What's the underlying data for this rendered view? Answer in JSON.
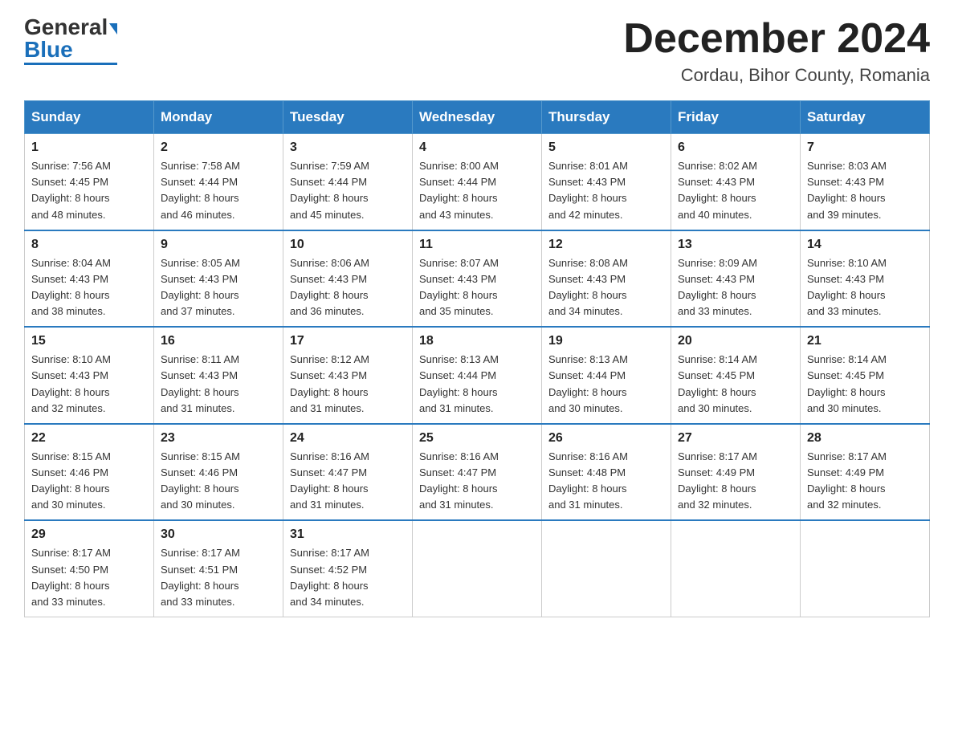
{
  "header": {
    "logo_general": "General",
    "logo_blue": "Blue",
    "month_title": "December 2024",
    "location": "Cordau, Bihor County, Romania"
  },
  "weekdays": [
    "Sunday",
    "Monday",
    "Tuesday",
    "Wednesday",
    "Thursday",
    "Friday",
    "Saturday"
  ],
  "weeks": [
    [
      {
        "day": "1",
        "sunrise": "7:56 AM",
        "sunset": "4:45 PM",
        "daylight": "8 hours and 48 minutes."
      },
      {
        "day": "2",
        "sunrise": "7:58 AM",
        "sunset": "4:44 PM",
        "daylight": "8 hours and 46 minutes."
      },
      {
        "day": "3",
        "sunrise": "7:59 AM",
        "sunset": "4:44 PM",
        "daylight": "8 hours and 45 minutes."
      },
      {
        "day": "4",
        "sunrise": "8:00 AM",
        "sunset": "4:44 PM",
        "daylight": "8 hours and 43 minutes."
      },
      {
        "day": "5",
        "sunrise": "8:01 AM",
        "sunset": "4:43 PM",
        "daylight": "8 hours and 42 minutes."
      },
      {
        "day": "6",
        "sunrise": "8:02 AM",
        "sunset": "4:43 PM",
        "daylight": "8 hours and 40 minutes."
      },
      {
        "day": "7",
        "sunrise": "8:03 AM",
        "sunset": "4:43 PM",
        "daylight": "8 hours and 39 minutes."
      }
    ],
    [
      {
        "day": "8",
        "sunrise": "8:04 AM",
        "sunset": "4:43 PM",
        "daylight": "8 hours and 38 minutes."
      },
      {
        "day": "9",
        "sunrise": "8:05 AM",
        "sunset": "4:43 PM",
        "daylight": "8 hours and 37 minutes."
      },
      {
        "day": "10",
        "sunrise": "8:06 AM",
        "sunset": "4:43 PM",
        "daylight": "8 hours and 36 minutes."
      },
      {
        "day": "11",
        "sunrise": "8:07 AM",
        "sunset": "4:43 PM",
        "daylight": "8 hours and 35 minutes."
      },
      {
        "day": "12",
        "sunrise": "8:08 AM",
        "sunset": "4:43 PM",
        "daylight": "8 hours and 34 minutes."
      },
      {
        "day": "13",
        "sunrise": "8:09 AM",
        "sunset": "4:43 PM",
        "daylight": "8 hours and 33 minutes."
      },
      {
        "day": "14",
        "sunrise": "8:10 AM",
        "sunset": "4:43 PM",
        "daylight": "8 hours and 33 minutes."
      }
    ],
    [
      {
        "day": "15",
        "sunrise": "8:10 AM",
        "sunset": "4:43 PM",
        "daylight": "8 hours and 32 minutes."
      },
      {
        "day": "16",
        "sunrise": "8:11 AM",
        "sunset": "4:43 PM",
        "daylight": "8 hours and 31 minutes."
      },
      {
        "day": "17",
        "sunrise": "8:12 AM",
        "sunset": "4:43 PM",
        "daylight": "8 hours and 31 minutes."
      },
      {
        "day": "18",
        "sunrise": "8:13 AM",
        "sunset": "4:44 PM",
        "daylight": "8 hours and 31 minutes."
      },
      {
        "day": "19",
        "sunrise": "8:13 AM",
        "sunset": "4:44 PM",
        "daylight": "8 hours and 30 minutes."
      },
      {
        "day": "20",
        "sunrise": "8:14 AM",
        "sunset": "4:45 PM",
        "daylight": "8 hours and 30 minutes."
      },
      {
        "day": "21",
        "sunrise": "8:14 AM",
        "sunset": "4:45 PM",
        "daylight": "8 hours and 30 minutes."
      }
    ],
    [
      {
        "day": "22",
        "sunrise": "8:15 AM",
        "sunset": "4:46 PM",
        "daylight": "8 hours and 30 minutes."
      },
      {
        "day": "23",
        "sunrise": "8:15 AM",
        "sunset": "4:46 PM",
        "daylight": "8 hours and 30 minutes."
      },
      {
        "day": "24",
        "sunrise": "8:16 AM",
        "sunset": "4:47 PM",
        "daylight": "8 hours and 31 minutes."
      },
      {
        "day": "25",
        "sunrise": "8:16 AM",
        "sunset": "4:47 PM",
        "daylight": "8 hours and 31 minutes."
      },
      {
        "day": "26",
        "sunrise": "8:16 AM",
        "sunset": "4:48 PM",
        "daylight": "8 hours and 31 minutes."
      },
      {
        "day": "27",
        "sunrise": "8:17 AM",
        "sunset": "4:49 PM",
        "daylight": "8 hours and 32 minutes."
      },
      {
        "day": "28",
        "sunrise": "8:17 AM",
        "sunset": "4:49 PM",
        "daylight": "8 hours and 32 minutes."
      }
    ],
    [
      {
        "day": "29",
        "sunrise": "8:17 AM",
        "sunset": "4:50 PM",
        "daylight": "8 hours and 33 minutes."
      },
      {
        "day": "30",
        "sunrise": "8:17 AM",
        "sunset": "4:51 PM",
        "daylight": "8 hours and 33 minutes."
      },
      {
        "day": "31",
        "sunrise": "8:17 AM",
        "sunset": "4:52 PM",
        "daylight": "8 hours and 34 minutes."
      },
      null,
      null,
      null,
      null
    ]
  ],
  "labels": {
    "sunrise_prefix": "Sunrise: ",
    "sunset_prefix": "Sunset: ",
    "daylight_prefix": "Daylight: "
  }
}
